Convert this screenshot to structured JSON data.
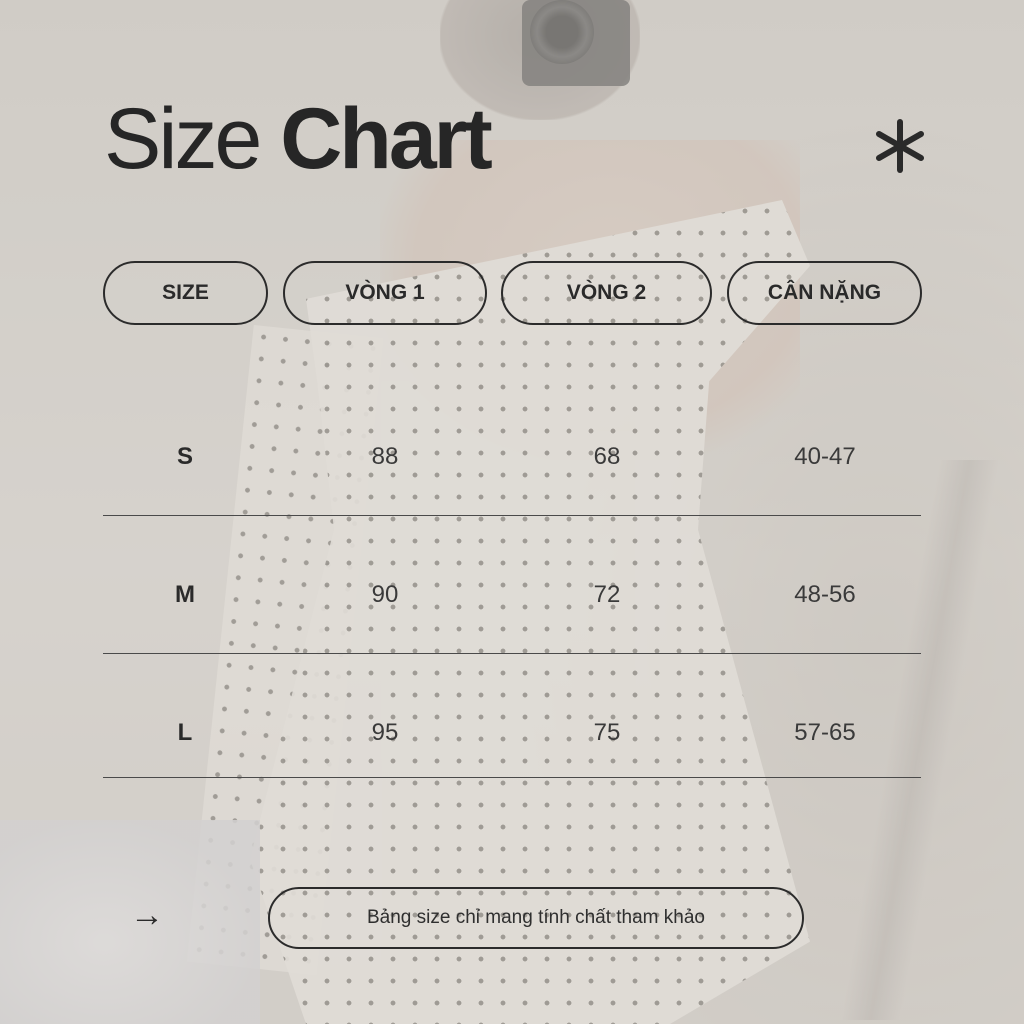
{
  "title": {
    "light": "Size",
    "bold": "Chart"
  },
  "decoration_icon": "asterisk-icon",
  "columns": [
    "SIZE",
    "VÒNG 1",
    "VÒNG 2",
    "CÂN NẶNG"
  ],
  "rows": [
    {
      "size": "S",
      "vong1": "88",
      "vong2": "68",
      "can_nang": "40-47"
    },
    {
      "size": "M",
      "vong1": "90",
      "vong2": "72",
      "can_nang": "48-56"
    },
    {
      "size": "L",
      "vong1": "95",
      "vong2": "75",
      "can_nang": "57-65"
    }
  ],
  "footer": {
    "arrow": "→",
    "note": "Bảng size chỉ mang tính chất tham khảo"
  },
  "colors": {
    "text": "#262626",
    "border": "#2b2b2b",
    "overlay": "#d6d2cd"
  }
}
